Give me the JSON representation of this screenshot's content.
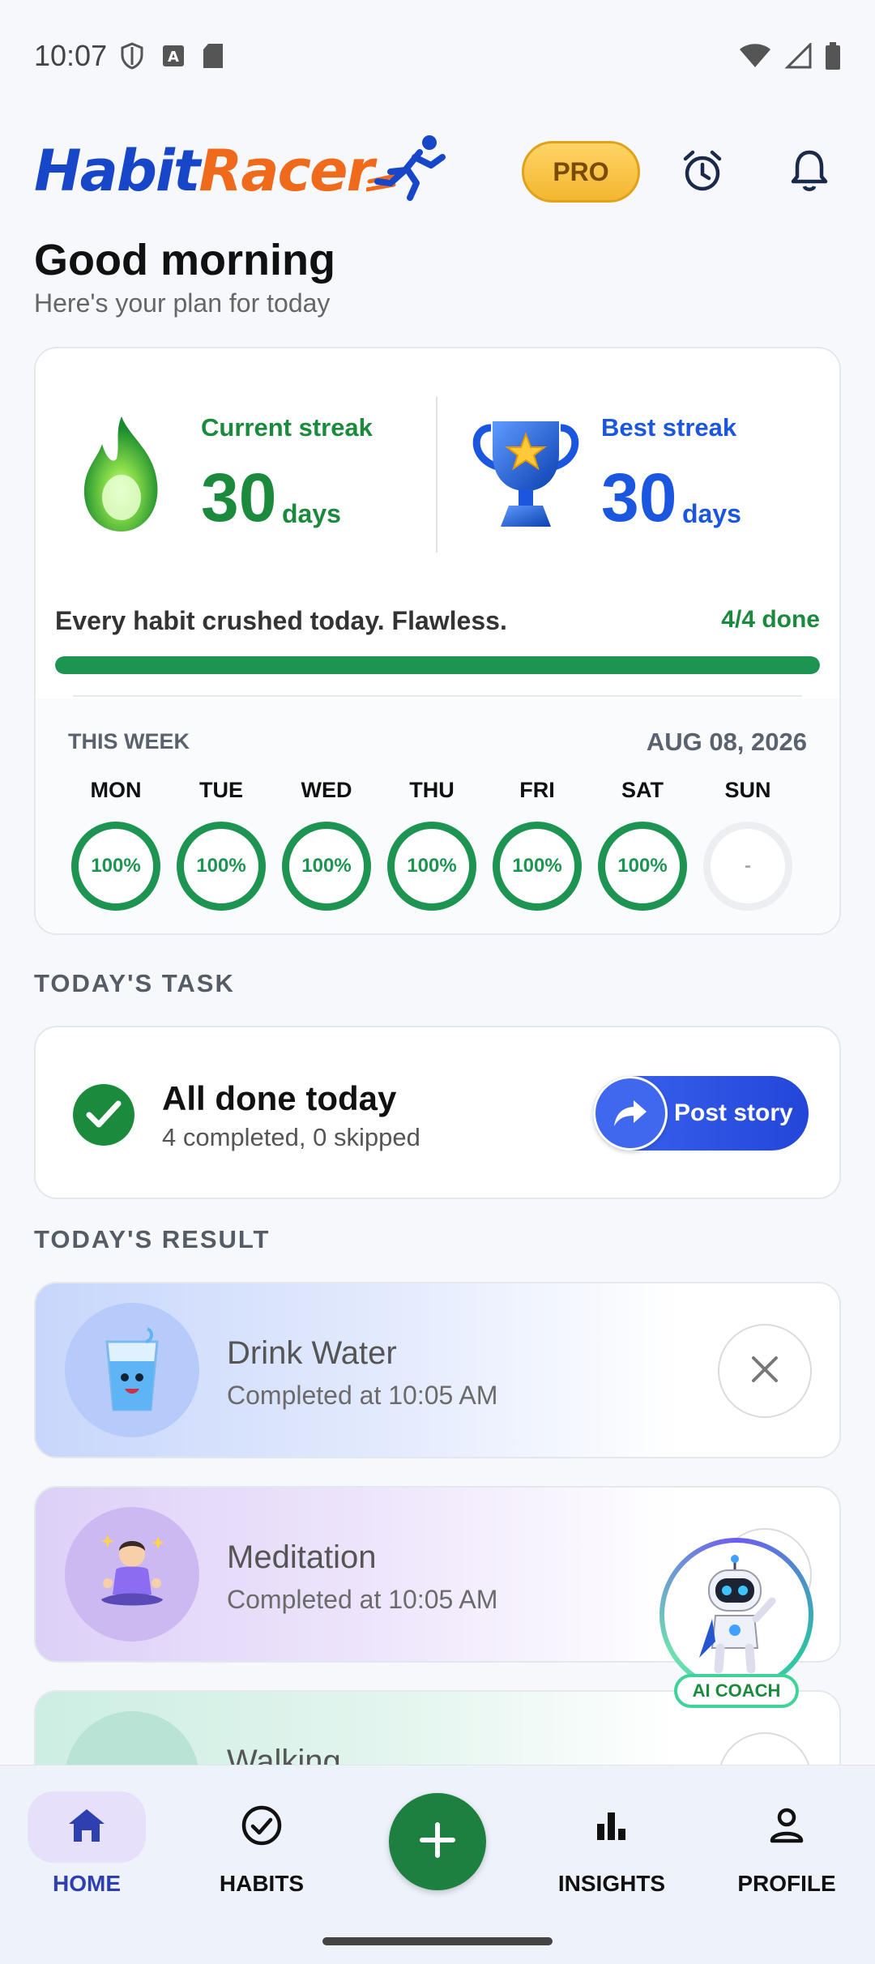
{
  "status_bar": {
    "time": "10:07"
  },
  "header": {
    "logo_part1": "Habit",
    "logo_part2": "Racer",
    "pro_label": "PRO"
  },
  "greeting": {
    "title": "Good morning",
    "subtitle": "Here's your plan for today"
  },
  "streaks": {
    "current": {
      "label": "Current streak",
      "value": "30",
      "unit": "days"
    },
    "best": {
      "label": "Best streak",
      "value": "30",
      "unit": "days"
    }
  },
  "progress": {
    "message": "Every habit crushed today. Flawless.",
    "done_label": "4/4 done",
    "fraction": 1.0
  },
  "week": {
    "label": "THIS WEEK",
    "date": "AUG 08, 2026",
    "days": [
      {
        "name": "MON",
        "value": "100%"
      },
      {
        "name": "TUE",
        "value": "100%"
      },
      {
        "name": "WED",
        "value": "100%"
      },
      {
        "name": "THU",
        "value": "100%"
      },
      {
        "name": "FRI",
        "value": "100%"
      },
      {
        "name": "SAT",
        "value": "100%"
      },
      {
        "name": "SUN",
        "value": "-"
      }
    ]
  },
  "today_task": {
    "section_title": "TODAY'S TASK",
    "title": "All done today",
    "subtitle": "4 completed, 0 skipped",
    "button_label": "Post story"
  },
  "today_result": {
    "section_title": "TODAY'S RESULT",
    "items": [
      {
        "name": "Drink Water",
        "status": "Completed at 10:05 AM"
      },
      {
        "name": "Meditation",
        "status": "Completed at 10:05 AM"
      },
      {
        "name": "Walking",
        "status": ""
      }
    ]
  },
  "ai_coach": {
    "label": "AI COACH"
  },
  "bottom_nav": {
    "items": [
      {
        "label": "HOME"
      },
      {
        "label": "HABITS"
      },
      {
        "label": "INSIGHTS"
      },
      {
        "label": "PROFILE"
      }
    ]
  },
  "colors": {
    "brand_blue": "#1746c9",
    "brand_orange": "#ef6a1b",
    "success_green": "#1c8a3d",
    "best_blue": "#1b56de",
    "pro_gold": "#f3b630"
  }
}
